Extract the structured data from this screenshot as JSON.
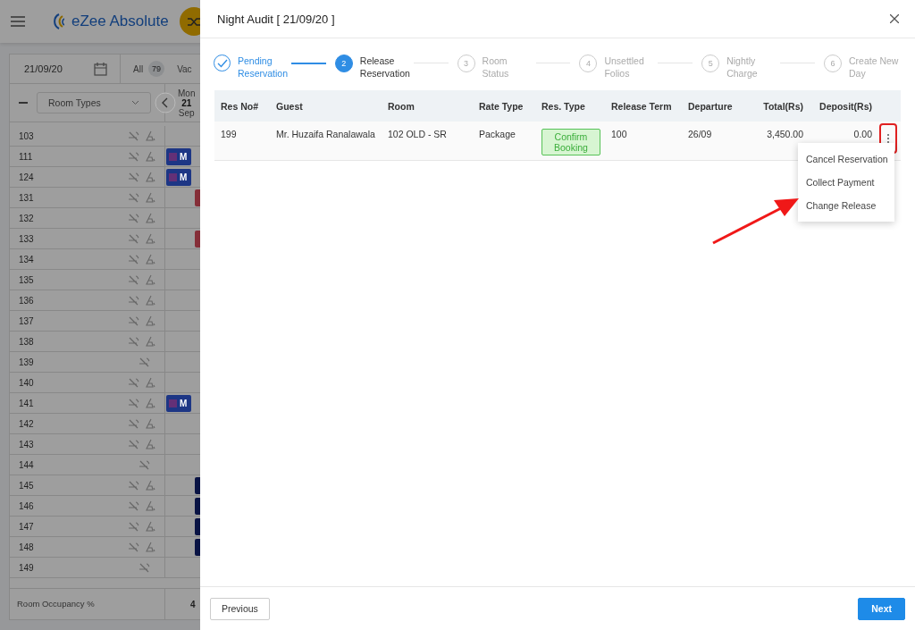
{
  "app": {
    "brand": "eZee Absolute",
    "date": "21/09/20",
    "filter_all": "All",
    "filter_all_count": "79",
    "filter_next": "Vac",
    "room_types": "Room Types",
    "day": {
      "weekday": "Mon",
      "date": "21",
      "month": "Sep"
    },
    "rooms": [
      {
        "number": "103",
        "housekeeping": true
      },
      {
        "number": "111",
        "housekeeping": true,
        "booking": {
          "kind": "chip",
          "color": "#1d3685",
          "text": "M"
        }
      },
      {
        "number": "124",
        "housekeeping": true,
        "booking": {
          "kind": "chip",
          "color": "#1d3685",
          "text": "M"
        }
      },
      {
        "number": "131",
        "housekeeping": true,
        "booking": {
          "kind": "stub",
          "color": "#852e38"
        }
      },
      {
        "number": "132",
        "housekeeping": true
      },
      {
        "number": "133",
        "housekeeping": true,
        "booking": {
          "kind": "stub",
          "color": "#852e38"
        }
      },
      {
        "number": "134",
        "housekeeping": true
      },
      {
        "number": "135",
        "housekeeping": true
      },
      {
        "number": "136",
        "housekeeping": true
      },
      {
        "number": "137",
        "housekeeping": true
      },
      {
        "number": "138",
        "housekeeping": true
      },
      {
        "number": "139",
        "housekeeping": false
      },
      {
        "number": "140",
        "housekeeping": true
      },
      {
        "number": "141",
        "housekeeping": true,
        "booking": {
          "kind": "chip",
          "color": "#1d3685",
          "text": "M"
        }
      },
      {
        "number": "142",
        "housekeeping": true
      },
      {
        "number": "143",
        "housekeeping": true
      },
      {
        "number": "144",
        "housekeeping": false
      },
      {
        "number": "145",
        "housekeeping": true,
        "booking": {
          "kind": "stub",
          "color": "#091344"
        }
      },
      {
        "number": "146",
        "housekeeping": true,
        "booking": {
          "kind": "stub",
          "color": "#091344"
        }
      },
      {
        "number": "147",
        "housekeeping": true,
        "booking": {
          "kind": "stub",
          "color": "#091344"
        }
      },
      {
        "number": "148",
        "housekeeping": true,
        "booking": {
          "kind": "stub",
          "color": "#091344"
        }
      },
      {
        "number": "149",
        "housekeeping": false
      }
    ],
    "occupancy_label": "Room Occupancy %",
    "occupancy_value": "4"
  },
  "dialog": {
    "title": "Night Audit [ 21/09/20 ]",
    "steps": [
      {
        "label": "Pending Reservation",
        "done": true,
        "selected": false
      },
      {
        "number": "2",
        "label": "Release Reservation",
        "done": false,
        "selected": true
      },
      {
        "number": "3",
        "label": "Room Status",
        "done": false,
        "selected": false
      },
      {
        "number": "4",
        "label": "Unsettled Folios",
        "done": false,
        "selected": false
      },
      {
        "number": "5",
        "label": "Nightly Charge",
        "done": false,
        "selected": false
      },
      {
        "number": "6",
        "label": "Create New Day",
        "done": false,
        "selected": false
      }
    ],
    "table": {
      "columns": [
        "Res No#",
        "Guest",
        "Room",
        "Rate Type",
        "Res. Type",
        "Release Term",
        "Departure",
        "Total(Rs)",
        "Deposit(Rs)"
      ],
      "rows": [
        {
          "res_no": "199",
          "guest": "Mr. Huzaifa Ranalawala",
          "room": "102 OLD - SR",
          "rate_type": "Package",
          "res_type": "Confirm Booking",
          "release_term": "100",
          "departure": "26/09",
          "total": "3,450.00",
          "deposit": "0.00"
        }
      ]
    },
    "row_menu": {
      "open": true,
      "items": [
        "Cancel Reservation",
        "Collect Payment",
        "Change Release"
      ]
    },
    "buttons": {
      "previous": "Previous",
      "next": "Next"
    }
  }
}
